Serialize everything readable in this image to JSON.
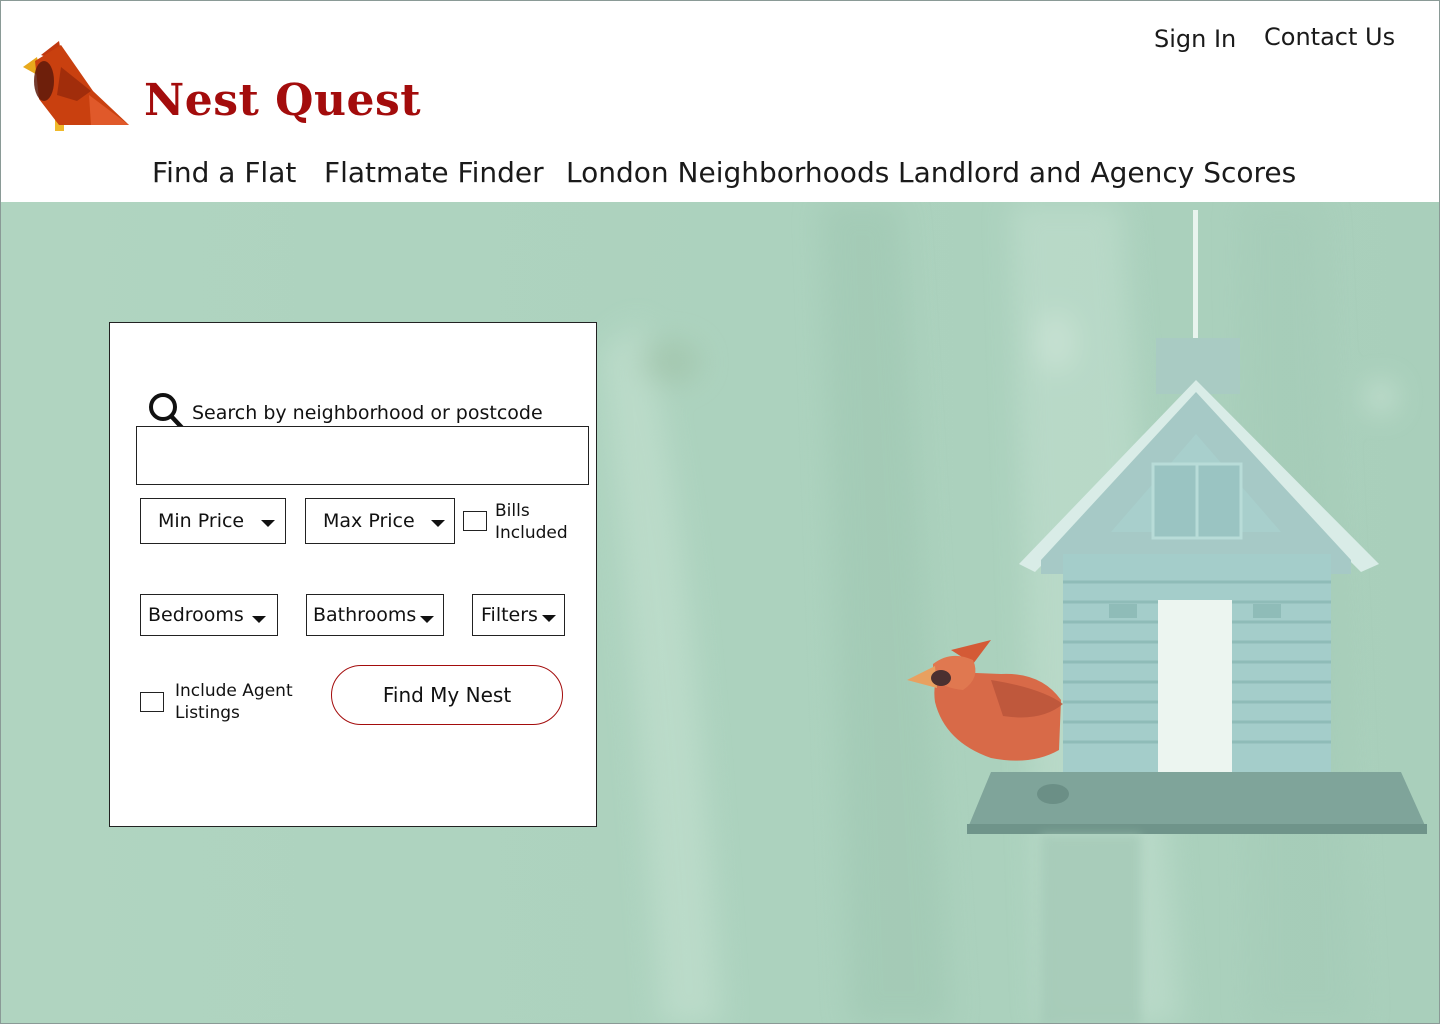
{
  "brand": {
    "name": "Nest Quest",
    "color": "#a30c0c"
  },
  "header": {
    "sign_in": "Sign In",
    "contact": "Contact Us"
  },
  "nav": {
    "items": [
      {
        "label": "Find a Flat"
      },
      {
        "label": "Flatmate Finder"
      },
      {
        "label": "London Neighborhoods"
      },
      {
        "label": "Landlord and Agency Scores"
      }
    ]
  },
  "hero": {
    "image": "cardinal-perched-on-birdhouse-feeder",
    "overlay_color": "#b1d5c1"
  },
  "search": {
    "label": "Search by neighborhood or postcode",
    "value": "",
    "placeholder": "",
    "icon": "search-icon"
  },
  "filters": {
    "min_price": "Min Price",
    "max_price": "Max Price",
    "bills_included": {
      "label": "Bills Included",
      "checked": false
    },
    "bedrooms": "Bedrooms",
    "bathrooms": "Bathrooms",
    "more": "Filters",
    "include_agent": {
      "label": "Include Agent Listings",
      "checked": false
    }
  },
  "actions": {
    "find": "Find My Nest"
  }
}
